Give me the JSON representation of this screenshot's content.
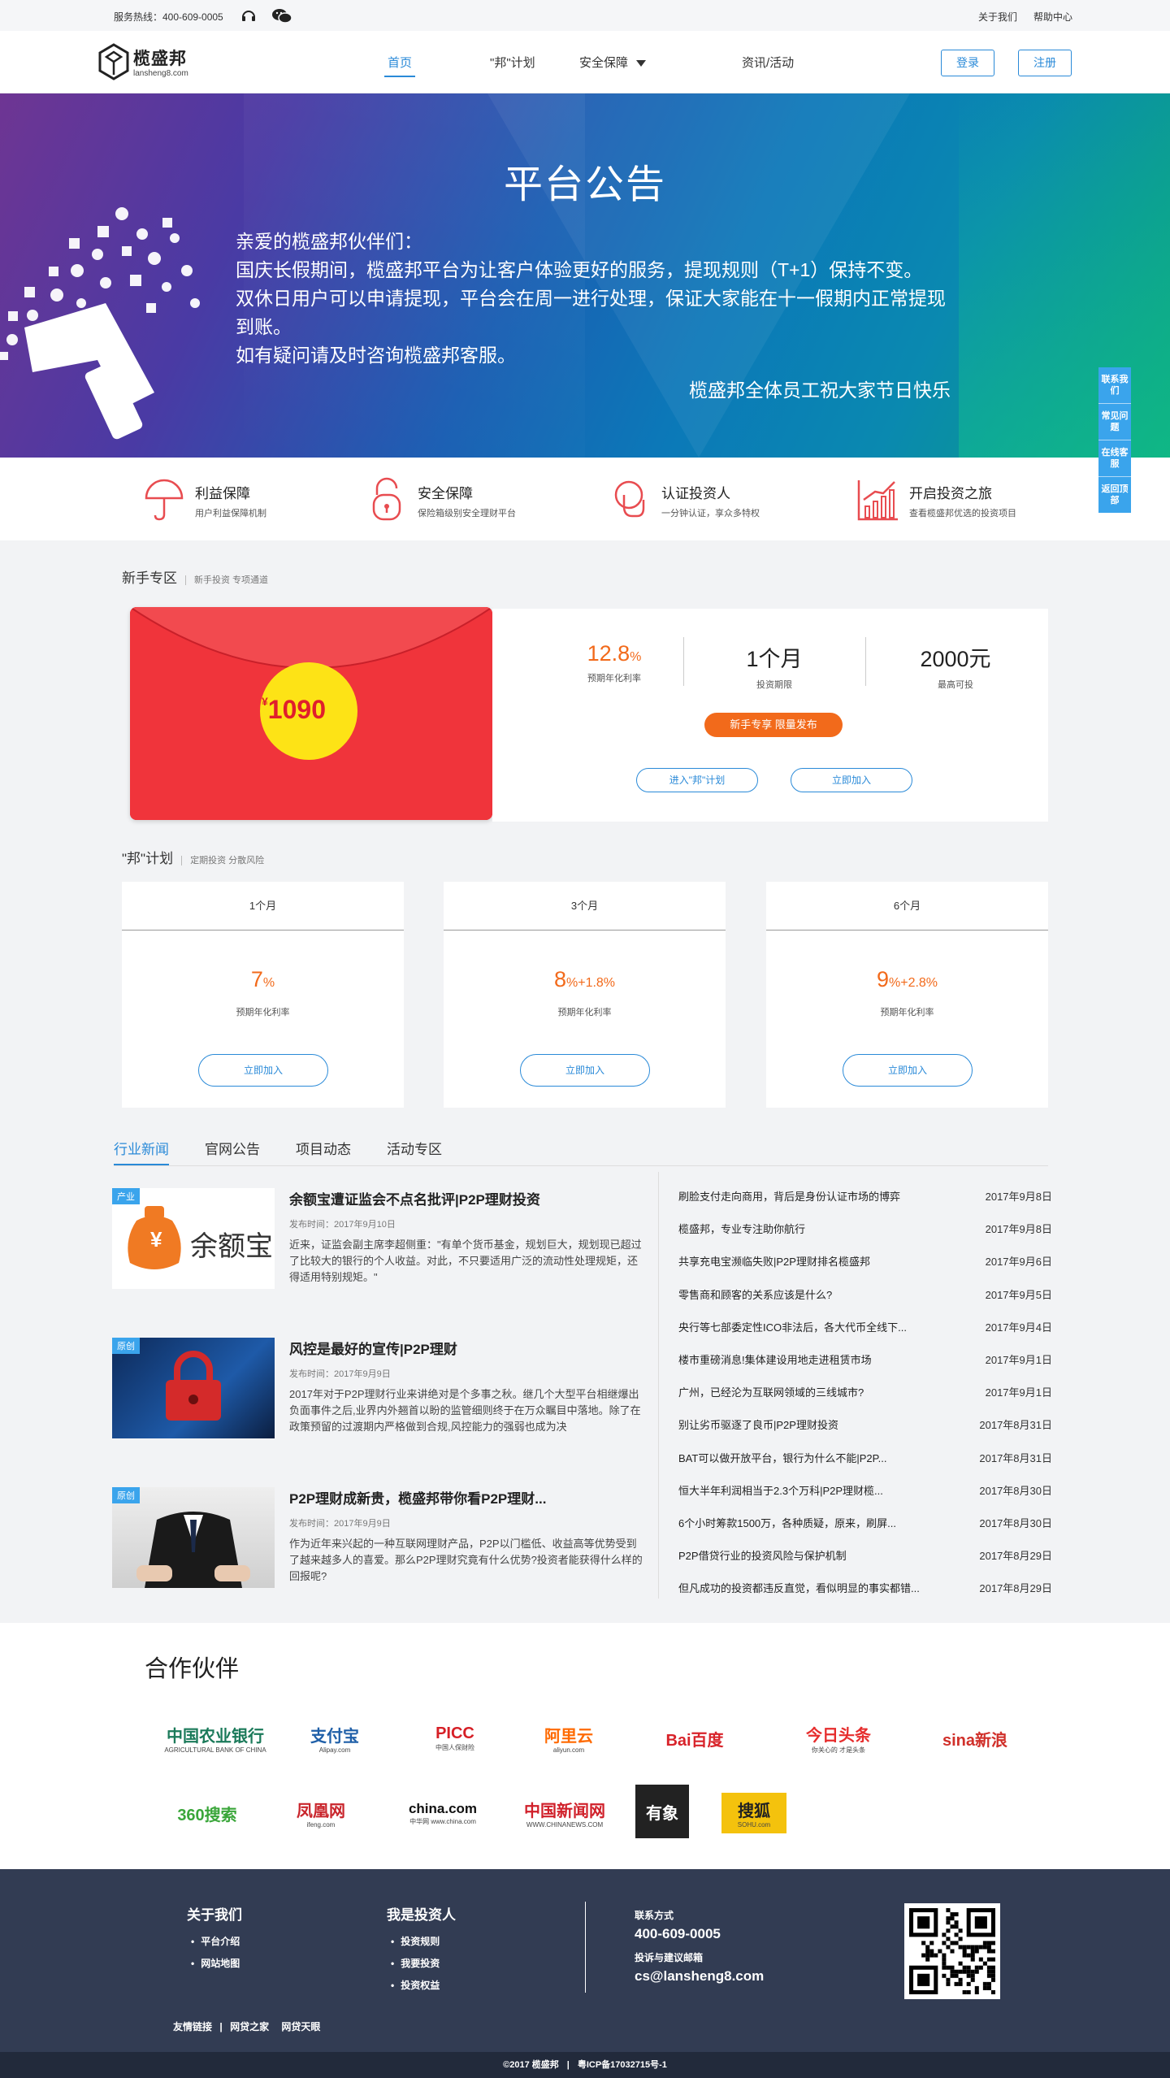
{
  "topbar": {
    "hotline": "服务热线：400-609-0005",
    "about": "关于我们",
    "help": "帮助中心",
    "icons": [
      "headset-icon",
      "wechat-icon"
    ]
  },
  "nav": {
    "logo_cn": "榄盛邦",
    "logo_en": "lansheng8.com",
    "items": [
      "首页",
      "\"邦\"计划",
      "安全保障",
      "资讯/活动"
    ],
    "login": "登录",
    "register": "注册"
  },
  "banner": {
    "title": "平台公告",
    "lines": [
      "亲爱的榄盛邦伙伴们：",
      "国庆长假期间，榄盛邦平台为让客户体验更好的服务，提现规则（T+1）保持不变。",
      "双休日用户可以申请提现，平台会在周一进行处理，保证大家能在十一假期内正常提现到账。",
      "如有疑问请及时咨询榄盛邦客服。"
    ],
    "sign": "榄盛邦全体员工祝大家节日快乐"
  },
  "sidefloat": [
    "联系我们",
    "常见问题",
    "在线客服",
    "返回顶部"
  ],
  "features": [
    {
      "title": "利益保障",
      "desc": "用户利益保障机制",
      "icon": "umbrella-icon"
    },
    {
      "title": "安全保障",
      "desc": "保险箱级别安全理财平台",
      "icon": "lock-icon"
    },
    {
      "title": "认证投资人",
      "desc": "一分钟认证，享众多特权",
      "icon": "hand-icon"
    },
    {
      "title": "开启投资之旅",
      "desc": "查看榄盛邦优选的投资项目",
      "icon": "growth-chart-icon"
    }
  ],
  "newbie": {
    "heading": "新手专区",
    "sub": "新手投资 专项通道",
    "envelope_currency": "¥",
    "envelope_amount": "1090",
    "rate": "12.8",
    "rate_unit": "%",
    "rate_label": "预期年化利率",
    "period": "1个月",
    "period_label": "投资期限",
    "max": "2000元",
    "max_label": "最高可投",
    "badge": "新手专享 限量发布",
    "enter_btn": "进入\"邦\"计划",
    "join_btn": "立即加入"
  },
  "plans": {
    "heading": "\"邦\"计划",
    "sub": "定期投资 分散风险",
    "items": [
      {
        "term": "1个月",
        "rate": "7",
        "extra": "",
        "label": "预期年化利率",
        "btn": "立即加入"
      },
      {
        "term": "3个月",
        "rate": "8",
        "extra": "+1.8%",
        "label": "预期年化利率",
        "btn": "立即加入"
      },
      {
        "term": "6个月",
        "rate": "9",
        "extra": "+2.8%",
        "label": "预期年化利率",
        "btn": "立即加入"
      }
    ]
  },
  "news": {
    "tabs": [
      "行业新闻",
      "官网公告",
      "项目动态",
      "活动专区"
    ],
    "articles": [
      {
        "tag": "产业",
        "title": "余额宝遭证监会不点名批评|P2P理财投资",
        "date": "发布时间：2017年9月10日",
        "text": "近来，证监会副主席李超侧重：\"有单个货币基金，规划巨大，规划现已超过了比较大的银行的个人收益。对此，不只要适用广泛的流动性处理规矩，还得适用特别规矩。\"",
        "thumb_text": "余额宝"
      },
      {
        "tag": "原创",
        "title": "风控是最好的宣传|P2P理财",
        "date": "发布时间：2017年9月9日",
        "text": "2017年对于P2P理财行业来讲绝对是个多事之秋。继几个大型平台相继爆出负面事件之后,业界内外翘首以盼的监管细则终于在万众瞩目中落地。除了在政策预留的过渡期内严格做到合规,风控能力的强弱也成为决",
        "thumb_text": ""
      },
      {
        "tag": "原创",
        "title": "P2P理财成新贵，榄盛邦带你看P2P理财...",
        "date": "发布时间：2017年9月9日",
        "text": "作为近年来兴起的一种互联网理财产品，P2P以门槛低、收益高等优势受到了越来越多人的喜爱。那么P2P理财究竟有什么优势?投资者能获得什么样的回报呢?",
        "thumb_text": ""
      }
    ],
    "list": [
      {
        "t": "刷脸支付走向商用，背后是身份认证市场的博弈",
        "d": "2017年9月8日"
      },
      {
        "t": "榄盛邦，专业专注助你航行",
        "d": "2017年9月8日"
      },
      {
        "t": "共享充电宝濒临失败|P2P理财排名榄盛邦",
        "d": "2017年9月6日"
      },
      {
        "t": "零售商和顾客的关系应该是什么?",
        "d": "2017年9月5日"
      },
      {
        "t": "央行等七部委定性ICO非法后，各大代币全线下...",
        "d": "2017年9月4日"
      },
      {
        "t": "楼市重磅消息!集体建设用地走进租赁市场",
        "d": "2017年9月1日"
      },
      {
        "t": "广州，已经沦为互联网领域的三线城市?",
        "d": "2017年9月1日"
      },
      {
        "t": "别让劣币驱逐了良币|P2P理财投资",
        "d": "2017年8月31日"
      },
      {
        "t": "BAT可以做开放平台，银行为什么不能|P2P...",
        "d": "2017年8月31日"
      },
      {
        "t": "恒大半年利润相当于2.3个万科|P2P理财榄...",
        "d": "2017年8月30日"
      },
      {
        "t": "6个小时筹款1500万，各种质疑，原来，刷屏...",
        "d": "2017年8月30日"
      },
      {
        "t": "P2P借贷行业的投资风险与保护机制",
        "d": "2017年8月29日"
      },
      {
        "t": "但凡成功的投资都违反直觉，看似明显的事实都错...",
        "d": "2017年8月29日"
      }
    ]
  },
  "partners": {
    "title": "合作伙伴",
    "logos": [
      {
        "name": "中国农业银行",
        "sub": "AGRICULTURAL BANK OF CHINA",
        "color": "#1b7a5a"
      },
      {
        "name": "支付宝",
        "sub": "Alipay.com",
        "color": "#1f5fa8"
      },
      {
        "name": "PICC",
        "sub": "中国人保财险",
        "color": "#d61f26"
      },
      {
        "name": "阿里云",
        "sub": "aliyun.com",
        "color": "#ff6a00"
      },
      {
        "name": "Bai百度",
        "sub": "",
        "color": "#d8232a"
      },
      {
        "name": "今日头条",
        "sub": "你关心的 才是头条",
        "color": "#e62d2d"
      },
      {
        "name": "sina新浪",
        "sub": "",
        "color": "#d0302a"
      },
      {
        "name": "360搜索",
        "sub": "",
        "color": "#3aa63a"
      },
      {
        "name": "凤凰网",
        "sub": "ifeng.com",
        "color": "#c9252c"
      },
      {
        "name": "china.com",
        "sub": "中华网 www.china.com",
        "color": "#111111"
      },
      {
        "name": "中国新闻网",
        "sub": "WWW.CHINANEWS.COM",
        "color": "#d0202a"
      },
      {
        "name": "有象",
        "sub": "",
        "color": "#222222"
      },
      {
        "name": "搜狐",
        "sub": "SOHU.com",
        "color": "#f4c20d"
      }
    ]
  },
  "footer": {
    "about_h": "关于我们",
    "about_items": [
      "平台介绍",
      "网站地图"
    ],
    "invest_h": "我是投资人",
    "invest_items": [
      "投资规则",
      "我要投资",
      "投资权益"
    ],
    "contact_h": "联系方式",
    "phone": "400-609-0005",
    "mail_h": "投诉与建议邮箱",
    "mail": "cs@lansheng8.com",
    "friend_label": "友情链接",
    "friends": [
      "网贷之家",
      "网贷天眼"
    ],
    "copyright": "©2017   榄盛邦",
    "icp": "粤ICP备17032715号-1"
  }
}
